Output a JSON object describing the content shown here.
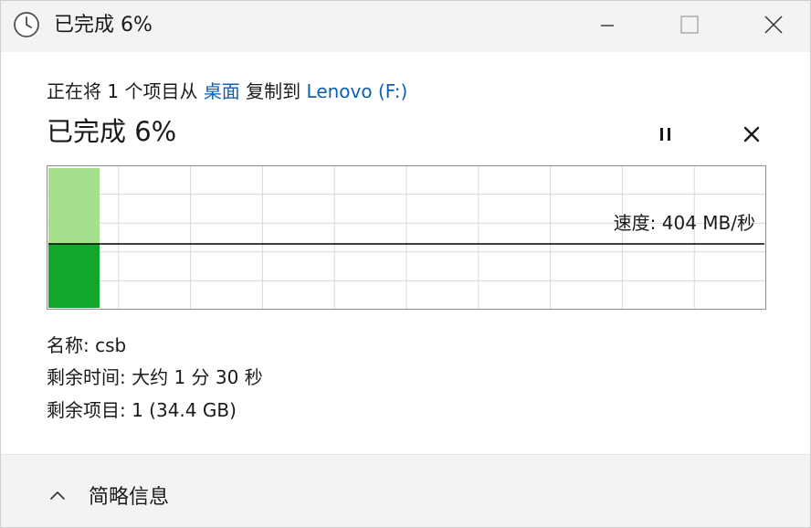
{
  "window": {
    "title": "已完成 6%",
    "controls": {
      "minimize_icon": "minimize-icon",
      "maximize_icon": "maximize-icon",
      "close_icon": "close-icon"
    }
  },
  "operation": {
    "prefix": "正在将 1 个项目从",
    "source": "桌面",
    "middle": "复制到",
    "destination": "Lenovo (F:)"
  },
  "progress": {
    "title": "已完成 6%",
    "percent": 6,
    "pause_icon": "pause-icon",
    "cancel_icon": "cancel-icon"
  },
  "speed_graph": {
    "speed_label": "速度: 404 MB/秒",
    "colors": {
      "completed_fill": "#11a72b",
      "remaining_fill": "#a7e08c",
      "grid": "#d8d8d8",
      "line": "#000000"
    }
  },
  "details": {
    "name": "名称: csb",
    "time_remaining": "剩余时间: 大约 1 分 30 秒",
    "items_remaining": "剩余项目: 1 (34.4 GB)"
  },
  "footer": {
    "toggle_label": "简略信息",
    "toggle_icon": "chevron-up-icon"
  }
}
